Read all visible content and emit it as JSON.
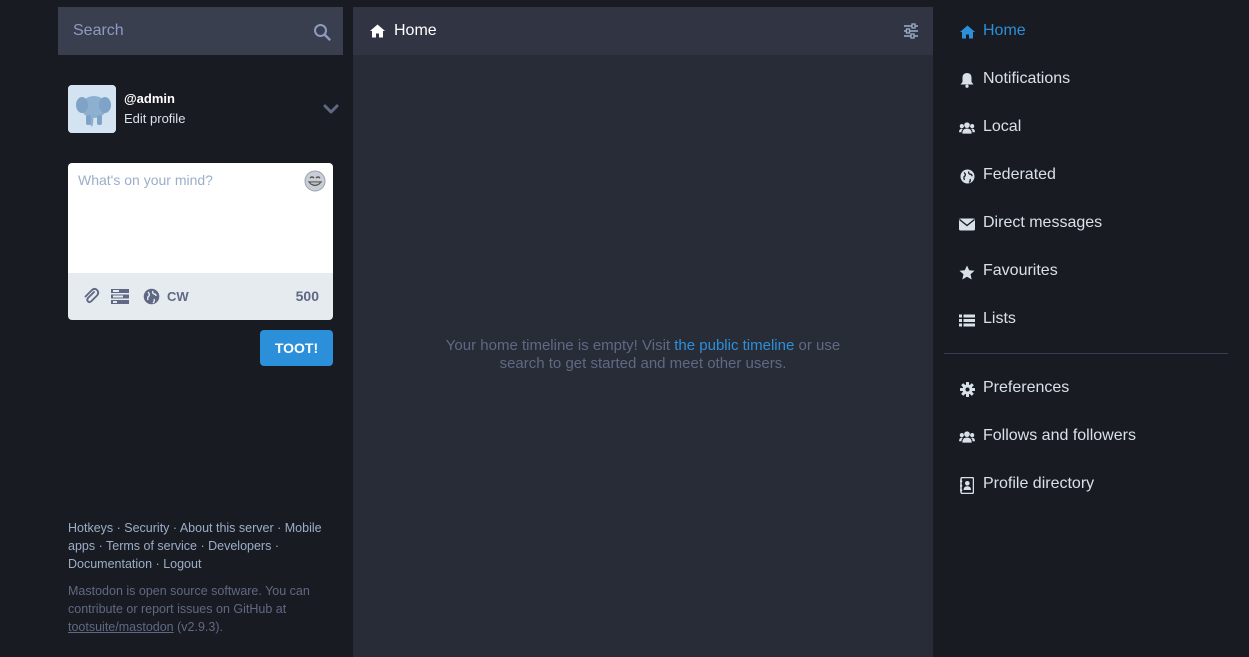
{
  "search": {
    "placeholder": "Search"
  },
  "account": {
    "handle": "@admin",
    "edit_profile": "Edit profile"
  },
  "composer": {
    "placeholder": "What's on your mind?",
    "cw_label": "CW",
    "char_count": "500",
    "submit_label": "TOOT!"
  },
  "footer": {
    "links": [
      "Hotkeys",
      "Security",
      "About this server",
      "Mobile apps",
      "Terms of service",
      "Developers",
      "Documentation",
      "Logout"
    ],
    "note_text": "Mastodon is open source software. You can contribute or report issues on GitHub at",
    "repo_link": "tootsuite/mastodon",
    "version": "(v2.9.3)."
  },
  "timeline": {
    "title": "Home",
    "empty_before": "Your home timeline is empty! Visit",
    "empty_link": "the public timeline",
    "empty_after": "or use search to get started and meet other users."
  },
  "nav": {
    "primary": [
      {
        "label": "Home",
        "icon": "home-icon",
        "active": true
      },
      {
        "label": "Notifications",
        "icon": "bell-icon"
      },
      {
        "label": "Local",
        "icon": "users-icon"
      },
      {
        "label": "Federated",
        "icon": "globe-icon"
      },
      {
        "label": "Direct messages",
        "icon": "envelope-icon"
      },
      {
        "label": "Favourites",
        "icon": "star-icon"
      },
      {
        "label": "Lists",
        "icon": "list-icon"
      }
    ],
    "secondary": [
      {
        "label": "Preferences",
        "icon": "gear-icon"
      },
      {
        "label": "Follows and followers",
        "icon": "users-icon"
      },
      {
        "label": "Profile directory",
        "icon": "address-book-icon"
      }
    ]
  },
  "colors": {
    "accent": "#2b90d9",
    "background": "#191b22",
    "column": "#282c37",
    "header": "#313543",
    "search": "#393f4f"
  }
}
